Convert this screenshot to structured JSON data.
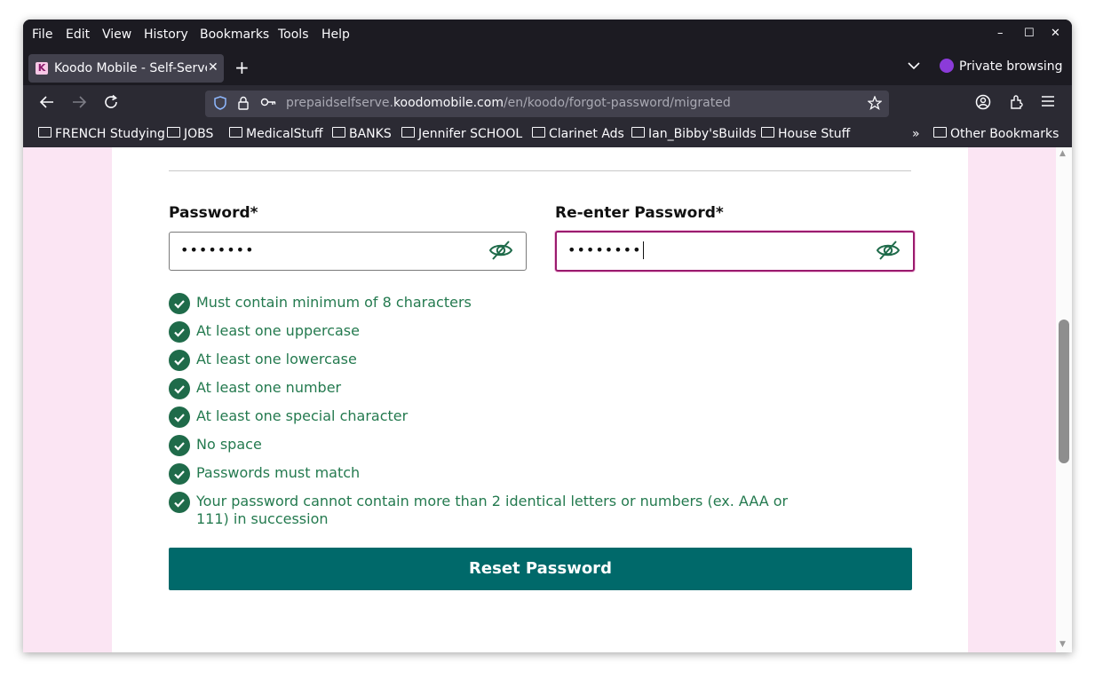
{
  "menubar": {
    "items": [
      "File",
      "Edit",
      "View",
      "History",
      "Bookmarks",
      "Tools",
      "Help"
    ]
  },
  "window_controls": {
    "minimize": "–",
    "maximize": "☐",
    "close": "✕"
  },
  "tab": {
    "title": "Koodo Mobile - Self-Serve",
    "favicon_letter": "K",
    "close": "✕"
  },
  "tabbar": {
    "new_tab": "+",
    "list_tabs": "⌄",
    "private_label": "Private browsing"
  },
  "navbar": {
    "url_prefix": "prepaidselfserve.",
    "url_host": "koodomobile.com",
    "url_path": "/en/koodo/forgot-password/migrated"
  },
  "bookmarks": {
    "items": [
      "FRENCH Studying",
      "JOBS",
      "MedicalStuff",
      "BANKS",
      "Jennifer SCHOOL",
      "Clarinet Ads",
      "Ian_Bibby'sBuilds",
      "House Stuff"
    ],
    "overflow": "»",
    "other": "Other Bookmarks"
  },
  "form": {
    "password_label": "Password*",
    "reenter_label": "Re-enter Password*",
    "password_value": "••••••••",
    "reenter_value": "••••••••",
    "rules": [
      "Must contain minimum of 8 characters",
      "At least one uppercase",
      "At least one lowercase",
      "At least one number",
      "At least one special character",
      "No space",
      "Passwords must match",
      "Your password cannot contain more than 2 identical letters or numbers (ex. AAA or 111) in succession"
    ],
    "submit_label": "Reset Password"
  },
  "colors": {
    "brand_teal": "#00696a",
    "rule_green": "#247a4f",
    "focus_magenta": "#9a1b6e",
    "page_background": "#fbe5f3"
  }
}
